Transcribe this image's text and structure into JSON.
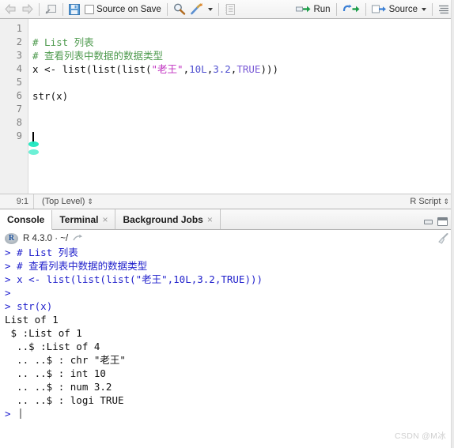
{
  "toolbar": {
    "back_icon": "back-arrow-icon",
    "forward_icon": "forward-arrow-icon",
    "popout_icon": "show-in-new-window-icon",
    "save_icon": "save-icon",
    "source_on_save_label": "Source on Save",
    "find_icon": "search-icon",
    "wand_icon": "magic-wand-icon",
    "compile_icon": "compile-report-icon",
    "run_label": "Run",
    "run_icon": "run-icon",
    "rerun_icon": "rerun-icon",
    "source_label": "Source",
    "source_icon": "source-icon",
    "outline_icon": "document-outline-icon"
  },
  "editor": {
    "line_numbers": [
      "1",
      "2",
      "3",
      "4",
      "5",
      "6",
      "7",
      "8",
      "9"
    ],
    "lines": [
      {
        "n": "1",
        "segments": []
      },
      {
        "n": "2",
        "segments": [
          {
            "t": "# List 列表",
            "c": "comment"
          }
        ]
      },
      {
        "n": "3",
        "segments": [
          {
            "t": "# 查看列表中数据的数据类型",
            "c": "comment"
          }
        ]
      },
      {
        "n": "4",
        "segments": [
          {
            "t": "x <- list(list(list(",
            "c": "plain"
          },
          {
            "t": "\"老王\"",
            "c": "string"
          },
          {
            "t": ",",
            "c": "plain"
          },
          {
            "t": "10L",
            "c": "num"
          },
          {
            "t": ",",
            "c": "plain"
          },
          {
            "t": "3.2",
            "c": "num"
          },
          {
            "t": ",",
            "c": "plain"
          },
          {
            "t": "TRUE",
            "c": "const"
          },
          {
            "t": ")))",
            "c": "plain"
          }
        ]
      },
      {
        "n": "5",
        "segments": []
      },
      {
        "n": "6",
        "segments": [
          {
            "t": "str(x)",
            "c": "plain"
          }
        ]
      },
      {
        "n": "7",
        "segments": []
      },
      {
        "n": "8",
        "segments": []
      },
      {
        "n": "9",
        "segments": []
      }
    ]
  },
  "editor_status": {
    "cursor_position": "9:1",
    "scope": "(Top Level)",
    "file_type": "R Script",
    "stepper_glyph": "⇕"
  },
  "console_tabs": {
    "items": [
      {
        "label": "Console",
        "closable": false,
        "active": true
      },
      {
        "label": "Terminal",
        "closable": true,
        "active": false
      },
      {
        "label": "Background Jobs",
        "closable": true,
        "active": false
      }
    ],
    "close_glyph": "×",
    "minimize_icon": "minimize-icon",
    "maximize_icon": "maximize-icon"
  },
  "console_header": {
    "logo_text": "R",
    "version_text": "R 4.3.0 · ~/",
    "popout_icon": "open-in-new-window-icon",
    "clear_icon": "broom-clear-console-icon"
  },
  "console": {
    "lines": [
      {
        "prompt": "> ",
        "text": "# List 列表",
        "style": "input"
      },
      {
        "prompt": "> ",
        "text": "# 查看列表中数据的数据类型",
        "style": "input"
      },
      {
        "prompt": "> ",
        "text": "x <- list(list(list(\"老王\",10L,3.2,TRUE)))",
        "style": "input"
      },
      {
        "prompt": "> ",
        "text": "",
        "style": "input"
      },
      {
        "prompt": "> ",
        "text": "str(x)",
        "style": "input"
      },
      {
        "prompt": "",
        "text": "List of 1",
        "style": "output"
      },
      {
        "prompt": "",
        "text": " $ :List of 1",
        "style": "output"
      },
      {
        "prompt": "",
        "text": "  ..$ :List of 4",
        "style": "output"
      },
      {
        "prompt": "",
        "text": "  .. ..$ : chr \"老王\"",
        "style": "output"
      },
      {
        "prompt": "",
        "text": "  .. ..$ : int 10",
        "style": "output"
      },
      {
        "prompt": "",
        "text": "  .. ..$ : num 3.2",
        "style": "output"
      },
      {
        "prompt": "",
        "text": "  .. ..$ : logi TRUE",
        "style": "output"
      }
    ],
    "final_prompt": "> "
  },
  "watermark": {
    "text": "CSDN @M冰"
  },
  "colors": {
    "comment": "#4e9a4e",
    "string": "#c030c0",
    "number": "#5050d0",
    "constant": "#7a5ad6",
    "console_input": "#2222cc",
    "accent_cursor": "#1ee8c0"
  }
}
